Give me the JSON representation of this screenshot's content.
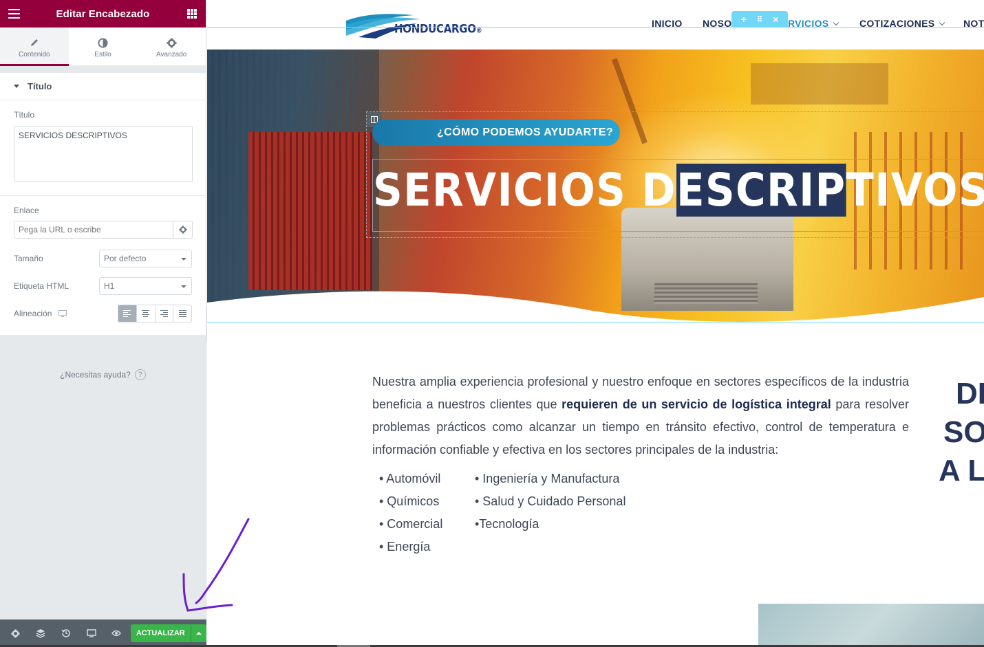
{
  "sidebar": {
    "header_title": "Editar Encabezado",
    "tabs": [
      {
        "label": "Contenido",
        "icon": "pencil-icon",
        "active": true
      },
      {
        "label": "Estilo",
        "icon": "half-circle-icon",
        "active": false
      },
      {
        "label": "Avanzado",
        "icon": "gear-icon",
        "active": false
      }
    ],
    "section_title": "Título",
    "title_label": "Título",
    "title_value": "SERVICIOS DESCRIPTIVOS",
    "link_label": "Enlace",
    "link_placeholder": "Pega la URL o escribe",
    "size_label": "Tamaño",
    "size_value": "Por defecto",
    "html_tag_label": "Etiqueta HTML",
    "html_tag_value": "H1",
    "align_label": "Alineación",
    "help_text": "¿Necesitas ayuda?",
    "help_icon": "?",
    "footer": {
      "update_label": "ACTUALIZAR",
      "icons": [
        "settings-icon",
        "layers-icon",
        "history-icon",
        "responsive-icon",
        "preview-icon"
      ]
    }
  },
  "site": {
    "logo_text": "HONDUCARGO",
    "logo_suffix": "®",
    "nav": [
      {
        "label": "INICIO",
        "dropdown": false
      },
      {
        "label": "NOSO",
        "dropdown": false
      },
      {
        "label": "RVICIOS",
        "dropdown": true
      },
      {
        "label": "COTIZACIONES",
        "dropdown": true
      },
      {
        "label": "NOT",
        "dropdown": false
      }
    ],
    "toolbar": {
      "add": "+",
      "move": "⠿",
      "close": "×"
    },
    "hero": {
      "pill_text": "¿CÓMO PODEMOS AYUDARTE?",
      "title_before": "SERVICIOS D",
      "title_selected": "ESCRIP",
      "title_after": "TIVOS"
    },
    "content": {
      "p_part1": "Nuestra amplia experiencia profesional y nuestro enfoque en sectores específicos de la industria beneficia a nuestros clientes que ",
      "p_bold": "requieren de un servicio de logística integral",
      "p_part2": " para resolver problemas prácticos como alcanzar un tiempo en tránsito efectivo, control de temperatura e información confiable y efectiva en los sectores principales de la industria:",
      "list_left": [
        "• Automóvil",
        "• Químicos",
        "• Comercial",
        "• Energía"
      ],
      "list_right": [
        "• Ingeniería y Manufactura",
        "• Salud y Cuidado Personal",
        "•Tecnología"
      ],
      "side_title": [
        "DI",
        "SO",
        "A L"
      ]
    }
  },
  "colors": {
    "brand": "#93003c",
    "update_green": "#39b54a",
    "editor_cyan": "#71d7f7",
    "navy": "#25355c"
  }
}
